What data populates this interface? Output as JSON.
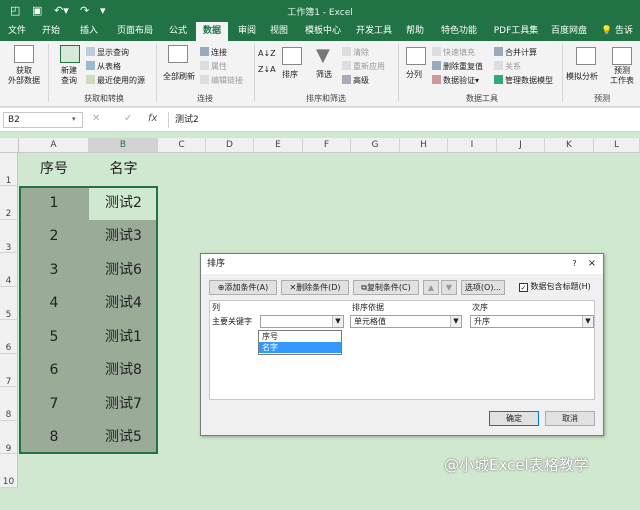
{
  "window": {
    "title": "工作簿1 - Excel"
  },
  "tabs": [
    "文件",
    "开始",
    "插入",
    "页面布局",
    "公式",
    "数据",
    "审阅",
    "视图",
    "模板中心",
    "开发工具",
    "帮助",
    "特色功能",
    "PDF工具集",
    "百度网盘"
  ],
  "active_tab": "数据",
  "tell_me": "告诉",
  "ribbon": {
    "get_external": "获取\n外部数据",
    "new_query": "新建\n查询",
    "show_query": "显示查询",
    "from_table": "从表格",
    "recent_sources": "最近使用的源",
    "group_get": "获取和转换",
    "refresh_all": "全部刷新",
    "connections": "连接",
    "properties": "属性",
    "edit_links": "编辑链接",
    "group_conn": "连接",
    "sort": "排序",
    "filter": "筛选",
    "clear": "清除",
    "reapply": "重新应用",
    "advanced": "高级",
    "group_sort": "排序和筛选",
    "split": "分列",
    "flash_fill": "快速填充",
    "remove_dup": "删除重复值",
    "validate": "数据验证",
    "consolidate": "合并计算",
    "relations": "关系",
    "manage_model": "管理数据模型",
    "group_tools": "数据工具",
    "whatif": "模拟分析",
    "forecast": "预测\n工作表",
    "group_forecast": "预测"
  },
  "formula_bar": {
    "name_box": "B2",
    "fx": "fx",
    "value": "测试2"
  },
  "columns": [
    "A",
    "B",
    "C",
    "D",
    "E",
    "F",
    "G",
    "H",
    "I",
    "J",
    "K",
    "L"
  ],
  "rows": [
    "1",
    "2",
    "3",
    "4",
    "5",
    "6",
    "7",
    "8",
    "9",
    "10"
  ],
  "sheet": {
    "header": [
      "序号",
      "名字"
    ],
    "data": [
      [
        "1",
        "测试2"
      ],
      [
        "2",
        "测试3"
      ],
      [
        "3",
        "测试6"
      ],
      [
        "4",
        "测试4"
      ],
      [
        "5",
        "测试1"
      ],
      [
        "6",
        "测试8"
      ],
      [
        "7",
        "测试7"
      ],
      [
        "8",
        "测试5"
      ]
    ]
  },
  "dialog": {
    "title": "排序",
    "help": "?",
    "close": "×",
    "add_level": "添加条件(A)",
    "delete_level": "删除条件(D)",
    "copy_level": "复制条件(C)",
    "options": "选项(O)...",
    "has_headers": "数据包含标题(H)",
    "col_column": "列",
    "col_sort_on": "排序依据",
    "col_order": "次序",
    "primary_key": "主要关键字",
    "sort_on_value": "单元格值",
    "order_value": "升序",
    "dropdown_options": [
      "序号",
      "名字"
    ],
    "dropdown_selected": "名字",
    "ok": "确定",
    "cancel": "取消"
  },
  "watermark": "@小城Excel表格教学"
}
